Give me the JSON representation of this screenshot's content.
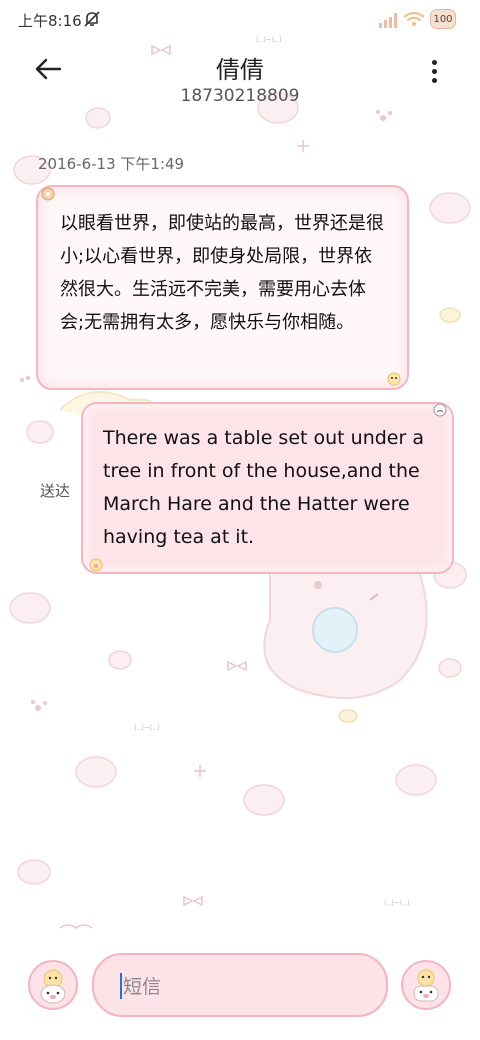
{
  "status_bar": {
    "time": "上午8:16",
    "battery": "100"
  },
  "header": {
    "name": "倩倩",
    "number": "18730218809"
  },
  "timestamp": "2016-6-13 下午1:49",
  "messages": {
    "received": "以眼看世界，即使站的最高，世界还是很小;以心看世界，即使身处局限，世界依然很大。生活远不完美，需要用心去体会;无需拥有太多，愿快乐与你相随。",
    "sent": "There was a table set out under a tree in front of the house,and the March Hare and the Hatter were having tea at it.",
    "sent_status": "送达"
  },
  "composer": {
    "placeholder": "短信"
  },
  "icons": {
    "back": "arrow-left-icon",
    "more": "more-vertical-icon",
    "mute": "bell-mute-icon",
    "signal": "signal-icon",
    "wifi": "wifi-icon",
    "battery": "battery-icon",
    "attach": "bear-avatar-icon",
    "send": "bear-send-icon"
  },
  "colors": {
    "bubble_border": "#f3b7c2",
    "bubble_bg": "#fde4e8",
    "caret": "#2a6fd6"
  }
}
